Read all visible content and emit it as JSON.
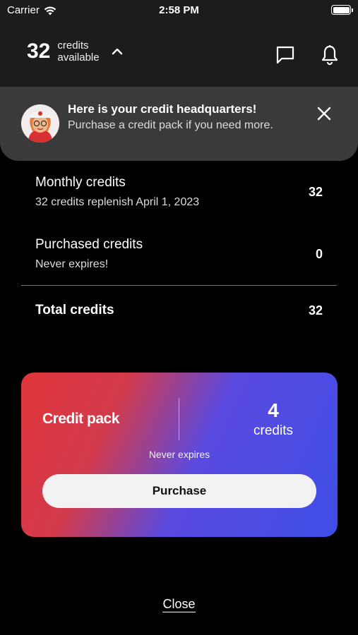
{
  "status_bar": {
    "carrier": "Carrier",
    "time": "2:58 PM"
  },
  "header": {
    "credits_count": "32",
    "credits_label_line1": "credits",
    "credits_label_line2": "available",
    "icons": [
      "chevron-up-icon",
      "message-icon",
      "bell-icon"
    ]
  },
  "banner": {
    "title": "Here is your credit headquarters!",
    "text": "Purchase a credit pack if you need more.",
    "icons": [
      "avatar",
      "close-icon"
    ]
  },
  "credits": {
    "monthly": {
      "label": "Monthly credits",
      "sub": "32 credits replenish April 1, 2023",
      "value": "32"
    },
    "purchased": {
      "label": "Purchased credits",
      "sub": "Never expires!",
      "value": "0"
    },
    "total": {
      "label": "Total credits",
      "value": "32"
    }
  },
  "pack": {
    "title": "Credit pack",
    "amount": "4",
    "unit": "credits",
    "expiry": "Never expires",
    "button_label": "Purchase",
    "gradient_colors": [
      "#e0353a",
      "#3d4ee6"
    ]
  },
  "footer": {
    "close_label": "Close"
  }
}
